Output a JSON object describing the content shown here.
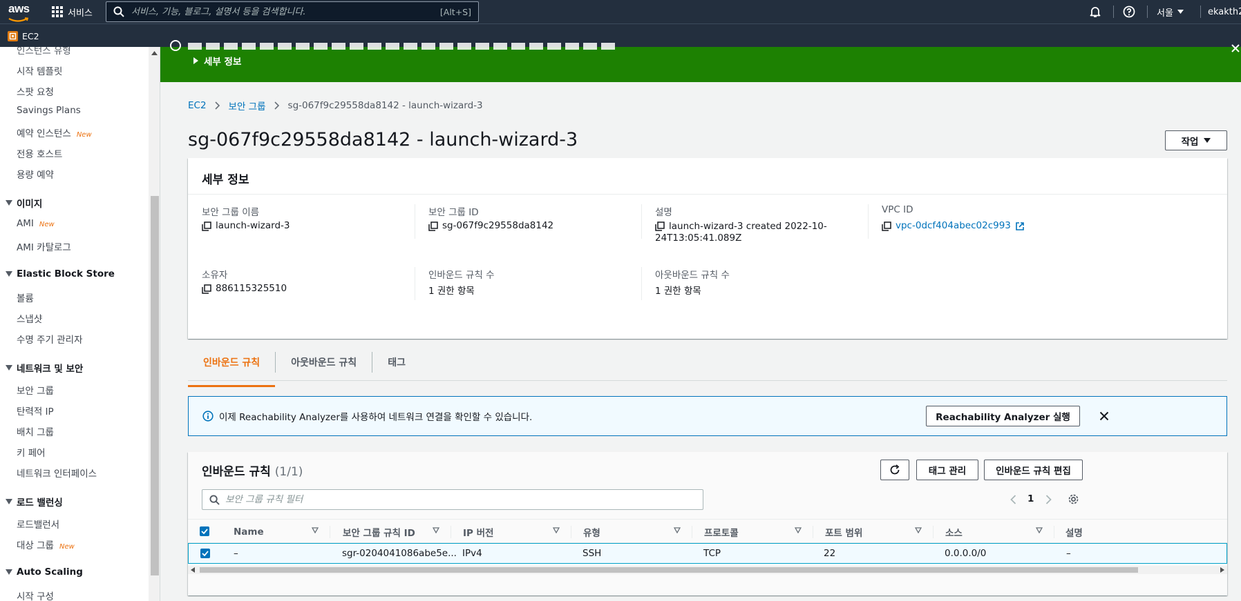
{
  "topnav": {
    "logo_text": "aws",
    "services_label": "서비스",
    "search_placeholder": "서비스, 기능, 블로그, 설명서 등을 검색합니다.",
    "search_shortcut": "[Alt+S]",
    "region": "서울",
    "user": "ekakth2"
  },
  "subnav": {
    "favorite_label": "EC2"
  },
  "sidebar": {
    "items_top": [
      {
        "label": "인스턴스 유형"
      },
      {
        "label": "시작 템플릿"
      },
      {
        "label": "스팟 요청"
      },
      {
        "label": "Savings Plans"
      },
      {
        "label": "예약 인스턴스",
        "badge": "New"
      },
      {
        "label": "전용 호스트"
      },
      {
        "label": "용량 예약"
      }
    ],
    "images_header": "이미지",
    "images_items": [
      {
        "label": "AMI",
        "badge": "New"
      },
      {
        "label": "AMI 카탈로그"
      }
    ],
    "ebs_header": "Elastic Block Store",
    "ebs_items": [
      {
        "label": "볼륨"
      },
      {
        "label": "스냅샷"
      },
      {
        "label": "수명 주기 관리자"
      }
    ],
    "network_header": "네트워크 및 보안",
    "network_items": [
      {
        "label": "보안 그룹"
      },
      {
        "label": "탄력적 IP"
      },
      {
        "label": "배치 그룹"
      },
      {
        "label": "키 페어"
      },
      {
        "label": "네트워크 인터페이스"
      }
    ],
    "lb_header": "로드 밸런싱",
    "lb_items": [
      {
        "label": "로드밸런서"
      },
      {
        "label": "대상 그룹",
        "badge": "New"
      }
    ],
    "as_header": "Auto Scaling",
    "as_items": [
      {
        "label": "시작 구성"
      }
    ]
  },
  "banner": {
    "details_label": "세부 정보"
  },
  "breadcrumb": {
    "items": [
      "EC2",
      "보안 그룹",
      "sg-067f9c29558da8142 - launch-wizard-3"
    ]
  },
  "page": {
    "title": "sg-067f9c29558da8142 - launch-wizard-3",
    "actions_label": "작업"
  },
  "details": {
    "header": "세부 정보",
    "name_label": "보안 그룹 이름",
    "name_value": "launch-wizard-3",
    "id_label": "보안 그룹 ID",
    "id_value": "sg-067f9c29558da8142",
    "desc_label": "설명",
    "desc_value_line1": "launch-wizard-3 created 2022-10-",
    "desc_value_line2": "24T13:05:41.089Z",
    "vpc_label": "VPC ID",
    "vpc_value": "vpc-0dcf404abec02c993",
    "owner_label": "소유자",
    "owner_value": "886115325510",
    "inbound_count_label": "인바운드 규칙 수",
    "inbound_count_value": "1 권한 항목",
    "outbound_count_label": "아웃바운드 규칙 수",
    "outbound_count_value": "1 권한 항목"
  },
  "tabs": [
    "인바운드 규칙",
    "아웃바운드 규칙",
    "태그"
  ],
  "info_alert": {
    "message": "이제 Reachability Analyzer를 사용하여 네트워크 연결을 확인할 수 있습니다.",
    "button_label": "Reachability Analyzer 실행"
  },
  "rules": {
    "header": "인바운드 규칙",
    "count": "(1/1)",
    "manage_tags_label": "태그 관리",
    "edit_label": "인바운드 규칙 편집",
    "filter_placeholder": "보안 그룹 규칙 필터",
    "page_number": "1",
    "columns": [
      "Name",
      "보안 그룹 규칙 ID",
      "IP 버전",
      "유형",
      "프로토콜",
      "포트 범위",
      "소스",
      "설명"
    ],
    "rows": [
      {
        "name": "–",
        "rule_id": "sgr-0204041086abe5e...",
        "ip_version": "IPv4",
        "type": "SSH",
        "protocol": "TCP",
        "port_range": "22",
        "source": "0.0.0.0/0",
        "description": "–"
      }
    ]
  }
}
